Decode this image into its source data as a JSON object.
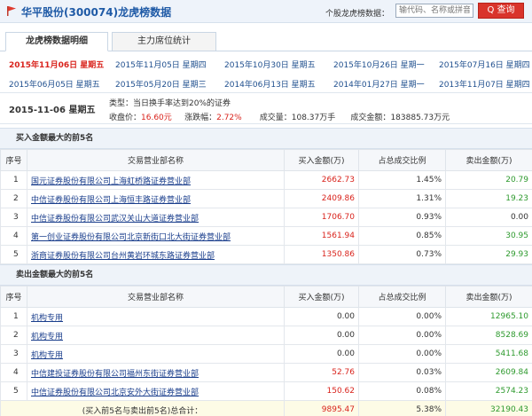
{
  "header": {
    "title": "华平股份(300074)龙虎榜数据",
    "search_label": "个股龙虎榜数据：",
    "search_placeholder": "输代码、名称或拼音",
    "search_button": "Q 查询"
  },
  "tabs": [
    {
      "label": "龙虎榜数据明细",
      "active": true
    },
    {
      "label": "主力席位统计",
      "active": false
    }
  ],
  "dates": [
    [
      "2015年11月06日  星期五",
      "2015年11月05日  星期四",
      "2015年10月30日  星期五",
      "2015年10月26日  星期一",
      "2015年07月16日  星期四"
    ],
    [
      "2015年06月05日  星期五",
      "2015年05月20日  星期三",
      "2014年06月13日  星期五",
      "2014年01月27日  星期一",
      "2013年11月07日  星期四"
    ]
  ],
  "info": {
    "day": "2015-11-06  星期五",
    "type_label": "类型：",
    "type_value": "当日换手率达到20%的证券",
    "close_label": "收盘价：",
    "close_value": "16.60元",
    "change_label": "涨跌幅：",
    "change_value": "2.72%",
    "volume_label": "成交量：",
    "volume_value": "108.37万手",
    "amount_label": "成交金额：",
    "amount_value": "183885.73万元"
  },
  "buy": {
    "title": "买入金额最大的前5名",
    "headers": [
      "序号",
      "交易营业部名称",
      "买入金额(万)",
      "占总成交比例",
      "卖出金额(万)"
    ],
    "rows": [
      {
        "no": "1",
        "name": "国元证券股份有限公司上海虹桥路证券营业部",
        "buy": "2662.73",
        "pct": "1.45%",
        "sell": "20.79"
      },
      {
        "no": "2",
        "name": "中信证券股份有限公司上海恒丰路证券营业部",
        "buy": "2409.86",
        "pct": "1.31%",
        "sell": "19.23"
      },
      {
        "no": "3",
        "name": "中信证券股份有限公司武汉关山大道证券营业部",
        "buy": "1706.70",
        "pct": "0.93%",
        "sell": "0.00"
      },
      {
        "no": "4",
        "name": "第一创业证券股份有限公司北京新街口北大街证券营业部",
        "buy": "1561.94",
        "pct": "0.85%",
        "sell": "30.95"
      },
      {
        "no": "5",
        "name": "浙商证券股份有限公司台州黄岩环城东路证券营业部",
        "buy": "1350.86",
        "pct": "0.73%",
        "sell": "29.93"
      }
    ]
  },
  "sell": {
    "title": "卖出金额最大的前5名",
    "headers": [
      "序号",
      "交易营业部名称",
      "买入金额(万)",
      "占总成交比例",
      "卖出金额(万)"
    ],
    "rows": [
      {
        "no": "1",
        "name": "机构专用",
        "buy": "0.00",
        "pct": "0.00%",
        "sell": "12965.10"
      },
      {
        "no": "2",
        "name": "机构专用",
        "buy": "0.00",
        "pct": "0.00%",
        "sell": "8528.69"
      },
      {
        "no": "3",
        "name": "机构专用",
        "buy": "0.00",
        "pct": "0.00%",
        "sell": "5411.68"
      },
      {
        "no": "4",
        "name": "中信建投证券股份有限公司福州东街证券营业部",
        "buy": "52.76",
        "pct": "0.03%",
        "sell": "2609.84"
      },
      {
        "no": "5",
        "name": "中信证券股份有限公司北京安外大街证券营业部",
        "buy": "150.62",
        "pct": "0.08%",
        "sell": "2574.23"
      }
    ],
    "total": {
      "label": "(买入前5名与卖出前5名)总合计：",
      "buy": "9895.47",
      "pct": "5.38%",
      "sell": "32190.43"
    }
  }
}
